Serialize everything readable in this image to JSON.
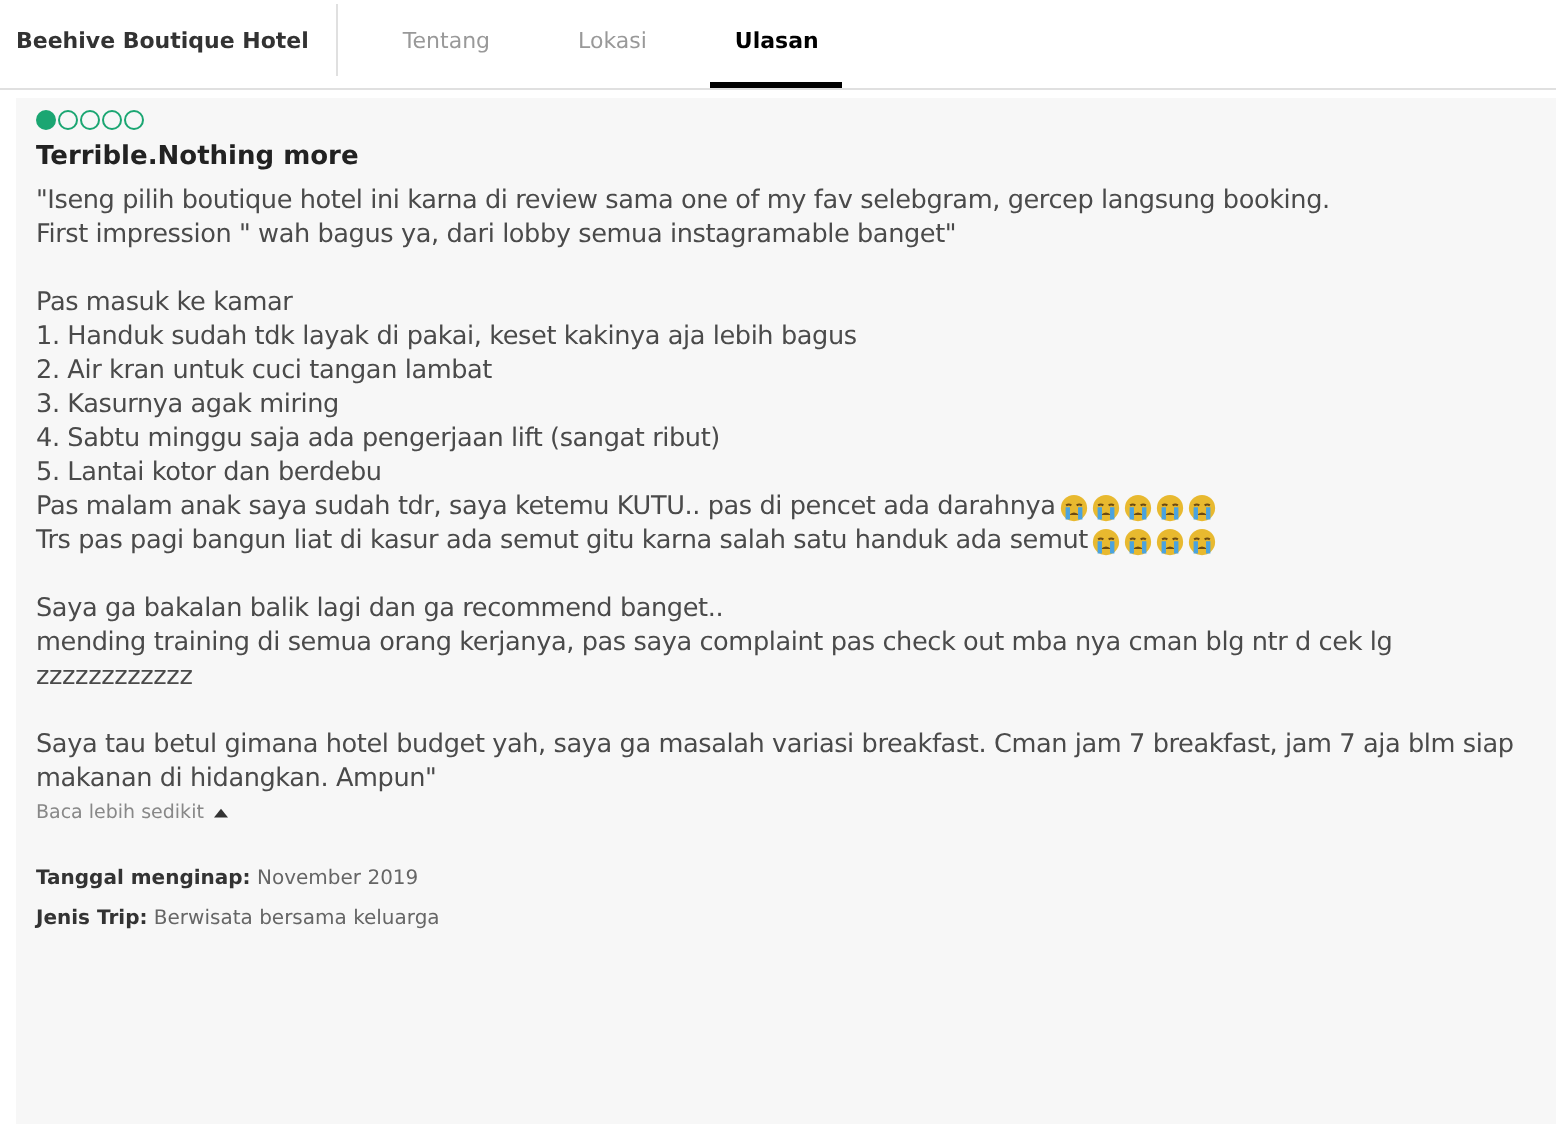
{
  "header": {
    "hotel_name": "Beehive Boutique Hotel",
    "tabs": [
      {
        "label": "Tentang",
        "selected": false
      },
      {
        "label": "Lokasi",
        "selected": false
      },
      {
        "label": "Ulasan",
        "selected": true
      }
    ]
  },
  "review": {
    "rating": {
      "stars": 1
    },
    "title": "Terrible.Nothing more",
    "paragraphs": [
      [
        [
          {
            "kind": "text",
            "text": "\"Iseng pilih boutique hotel ini karna di review sama one of my fav selebgram, gercep langsung booking."
          }
        ],
        [
          {
            "kind": "text",
            "text": "First impression \" wah bagus ya, dari lobby semua instagramable banget\""
          }
        ]
      ],
      [
        [
          {
            "kind": "text",
            "text": "Pas masuk ke kamar"
          }
        ],
        [
          {
            "kind": "text",
            "text": "1. Handuk sudah tdk layak di pakai, keset kakinya aja lebih bagus"
          }
        ],
        [
          {
            "kind": "text",
            "text": "2. Air kran untuk cuci tangan lambat"
          }
        ],
        [
          {
            "kind": "text",
            "text": "3. Kasurnya agak miring"
          }
        ],
        [
          {
            "kind": "text",
            "text": "4. Sabtu minggu saja ada pengerjaan lift (sangat ribut)"
          }
        ],
        [
          {
            "kind": "text",
            "text": "5. Lantai kotor dan berdebu"
          }
        ],
        [
          {
            "kind": "text",
            "text": "Pas malam anak saya sudah tdr, saya ketemu KUTU.. pas di pencet ada darahnya"
          },
          {
            "kind": "emoji"
          },
          {
            "kind": "emoji"
          },
          {
            "kind": "emoji"
          },
          {
            "kind": "emoji"
          },
          {
            "kind": "emoji"
          }
        ],
        [
          {
            "kind": "text",
            "text": "Trs pas pagi bangun liat di kasur ada semut gitu karna salah satu handuk ada semut"
          },
          {
            "kind": "emoji"
          },
          {
            "kind": "emoji"
          },
          {
            "kind": "emoji"
          },
          {
            "kind": "emoji"
          }
        ]
      ],
      [
        [
          {
            "kind": "text",
            "text": "Saya ga bakalan balik lagi dan ga recommend banget.."
          }
        ],
        [
          {
            "kind": "text",
            "text": "mending training di semua orang kerjanya, pas saya complaint pas check out mba nya cman blg ntr d cek lg zzzzzzzzzzzz"
          }
        ]
      ],
      [
        [
          {
            "kind": "text",
            "text": "Saya tau betul gimana hotel budget yah, saya ga masalah variasi breakfast. Cman jam 7 breakfast, jam 7 aja blm siap makanan di hidangkan. Ampun\""
          }
        ]
      ]
    ],
    "read_less": {
      "label": "Baca lebih sedikit",
      "expanded": true
    },
    "details": [
      {
        "label": "Tanggal menginap:",
        "value": "November 2019"
      },
      {
        "label": "Jenis Trip:",
        "value": "Berwisata bersama keluarga"
      }
    ]
  }
}
